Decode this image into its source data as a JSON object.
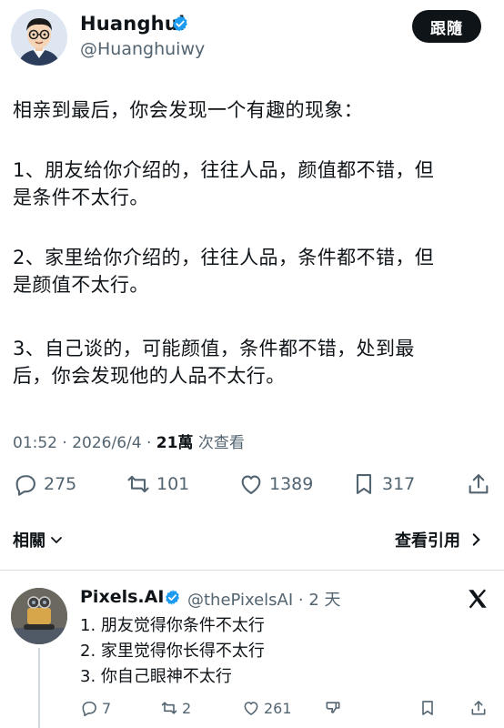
{
  "author": {
    "display_name": "Huanghui",
    "handle": "@Huanghuiwy",
    "follow_label": "跟隨"
  },
  "tweet": {
    "lines": [
      "相亲到最后，你会发现一个有趣的现象：",
      "1、朋友给你介绍的，往往人品，颜值都不错，但",
      "是条件不太行。",
      "2、家里给你介绍的，往往人品，条件都不错，但",
      "是颜值不太行。",
      "3、自己谈的，可能颜值，条件都不错，处到最",
      "后，你会发现他的人品不太行。"
    ],
    "time_date": "01:52 · 2026/6/4 · ",
    "views": "21萬",
    "views_label": " 次查看"
  },
  "actions": {
    "replies": "275",
    "retweets": "101",
    "likes": "1389",
    "bookmarks": "317"
  },
  "related_label": "相關",
  "view_quotes_label": "查看引用",
  "reply": {
    "display_name": "Pixels.AI",
    "handle_time": "@thePixelsAI · 2 天",
    "lines": [
      "1. 朋友觉得你条件不太行",
      "2. 家里觉得你长得不太行",
      "3. 你自己眼神不太行"
    ],
    "replies": "7",
    "retweets": "2",
    "likes": "261"
  },
  "colors": {
    "verified": "#1d9bf0",
    "muted": "#536471",
    "text": "#0f1419"
  }
}
